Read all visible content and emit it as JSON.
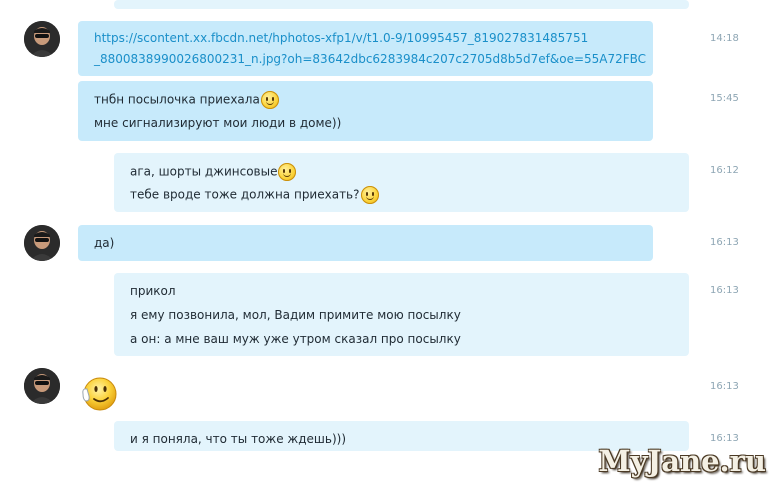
{
  "messages": [
    {
      "time": "14:18",
      "lines": [
        "https://scontent.xx.fbcdn.net/hphotos-xfp1/v/t1.0-9/10995457_819027831485751",
        "_8800838990026800231_n.jpg?oh=83642dbc6283984c207c2705d8b5d7ef&oe=55A72FBC"
      ]
    },
    {
      "time": "15:45",
      "lines": [
        "тнбн посылочка приехала",
        "мне сигнализируют мои люди в доме))"
      ]
    },
    {
      "time": "16:12",
      "lines": [
        "ага, шорты джинсовые",
        "тебе вроде тоже должна приехать?"
      ]
    },
    {
      "time": "16:13",
      "lines": [
        "да)"
      ]
    },
    {
      "time": "16:13",
      "lines": [
        "прикол",
        "я ему позвонила, мол, Вадим примите мою посылку",
        "а он: а мне ваш муж уже утром сказал про посылку"
      ]
    },
    {
      "time": "16:13",
      "lines": []
    },
    {
      "time": "16:13",
      "lines": [
        "и я поняла, что ты тоже ждешь)))"
      ]
    }
  ],
  "icons": {
    "emoticon": "smiley-icon",
    "avatar": "user-avatar-sunglasses"
  },
  "watermark": "MyJane.ru",
  "colors": {
    "incoming_bubble": "#c7eafb",
    "outgoing_bubble": "#e3f4fc",
    "link": "#1a8fc9",
    "timestamp": "#8ea6b4"
  }
}
